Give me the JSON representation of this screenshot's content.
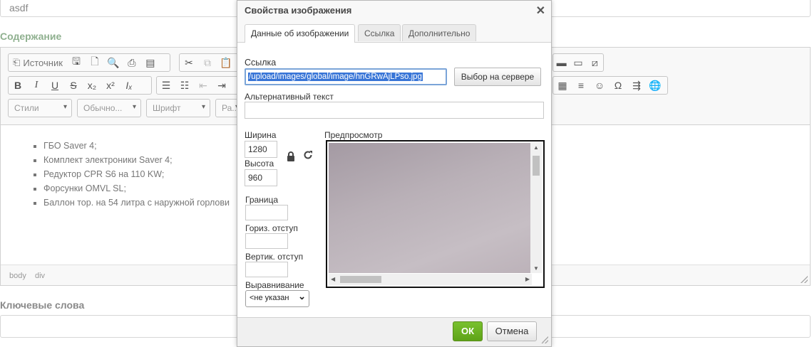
{
  "page": {
    "top_field_value": "asdf",
    "content_label": "Содержание",
    "keywords_label": "Ключевые слова"
  },
  "editor": {
    "source_label": "Источник",
    "styles_combo": "Стили",
    "format_combo": "Обычно...",
    "font_combo": "Шрифт",
    "size_combo": "Ра...",
    "list_items": [
      "ГБО Saver 4;",
      "Комплект электроники Saver 4;",
      "Редуктор CPR S6 на 110 KW;",
      "Форсунки OMVL SL;",
      "Баллон тор. на 54 литра с наружной горлови"
    ],
    "path": [
      "body",
      "div"
    ]
  },
  "dialog": {
    "title": "Свойства изображения",
    "tabs": [
      "Данные об изображении",
      "Ссылка",
      "Дополнительно"
    ],
    "url_label": "Ссылка",
    "url_value": "/upload/images/global/image/hnGRwAjLPso.jpg",
    "browse_button": "Выбор на сервере",
    "alt_label": "Альтернативный текст",
    "alt_value": "",
    "width_label": "Ширина",
    "width_value": "1280",
    "height_label": "Высота",
    "height_value": "960",
    "border_label": "Граница",
    "hspace_label": "Гориз. отступ",
    "vspace_label": "Вертик. отступ",
    "align_label": "Выравнивание",
    "align_value": "<не указан",
    "preview_label": "Предпросмотр",
    "ok_button": "ОК",
    "cancel_button": "Отмена"
  },
  "icons": {
    "close": "close-icon",
    "lock": "lock-icon",
    "reset": "reset-size-icon"
  },
  "colors": {
    "ok_green": "#6cb323",
    "url_highlight": "#3875d7",
    "section_label_green": "#8fb08f"
  }
}
